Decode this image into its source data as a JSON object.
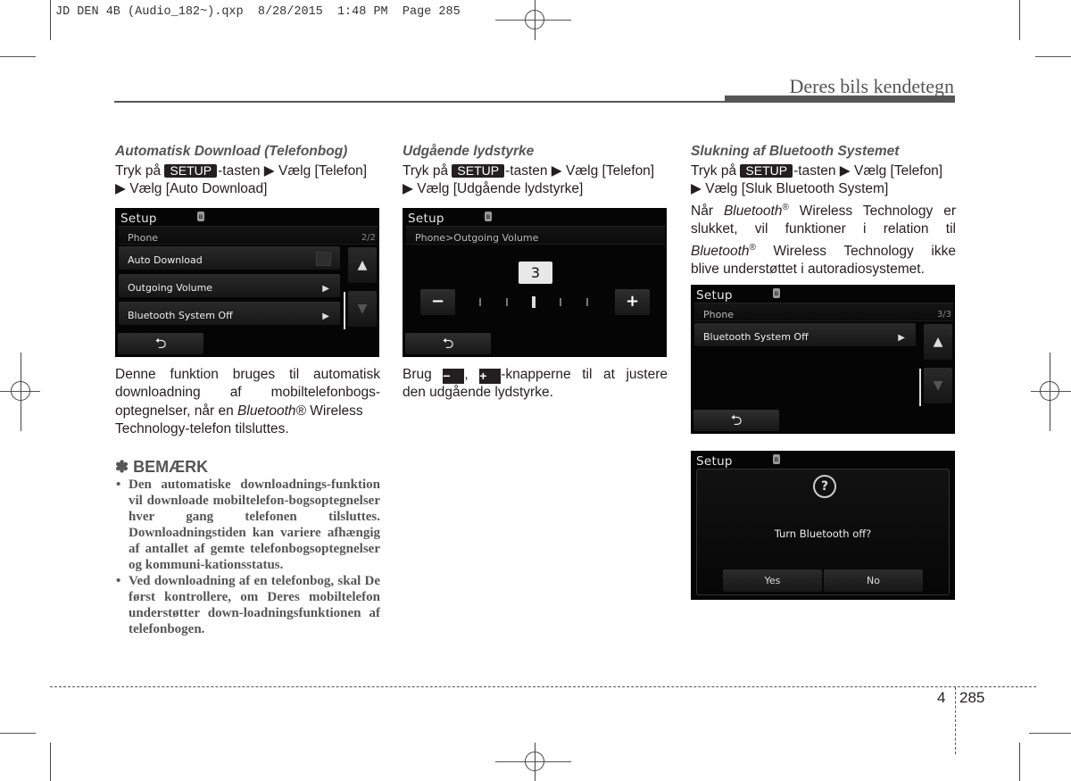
{
  "print_slug": "JD DEN 4B (Audio_182~).qxp  8/28/2015  1:48 PM  Page 285",
  "header": {
    "chapter_title": "Deres bils kendetegn"
  },
  "key_label": "SETUP",
  "col1": {
    "subtitle": "Automatisk Download (Telefonbog)",
    "step_prefix": "Tryk på ",
    "step_mid": "-tasten ▶ Vælg [Telefon]",
    "step_line2": "▶ Vælg [Auto Download]",
    "screen": {
      "title": "Setup",
      "breadcrumb": "Phone",
      "page": "2/2",
      "rows": [
        {
          "label": "Auto Download",
          "control": "checkbox"
        },
        {
          "label": "Outgoing Volume",
          "control": "arrow"
        },
        {
          "label": "Bluetooth System Off",
          "control": "arrow"
        }
      ],
      "up": "▲",
      "down": "▼",
      "back": "⮌"
    },
    "body": [
      "Denne funktion bruges til automatisk",
      "downloadning af mobiltelefonbogs-",
      "optegnelser, når en ",
      "Bluetooth®",
      " Wireless",
      "Technology-telefon tilsluttes."
    ],
    "note": {
      "heading": "✽ BEMÆRK",
      "items": [
        "Den automatiske downloadnings-funktion vil downloade mobiltelefon-bogsoptegnelser hver gang telefonen tilsluttes. Downloadningstiden kan variere afhængig af antallet af gemte telefonbogsoptegnelser og kommuni-kationsstatus.",
        "Ved downloadning af en telefonbog, skal De først kontrollere, om Deres mobiltelefon understøtter down-loadningsfunktionen af telefonbogen."
      ]
    }
  },
  "col2": {
    "subtitle": "Udgående lydstyrke",
    "step_prefix": "Tryk på ",
    "step_mid": "-tasten ▶ Vælg [Telefon]",
    "step_line2": "▶ Vælg [Udgående lydstyrke]",
    "screen": {
      "title": "Setup",
      "breadcrumb": "Phone>Outgoing Volume",
      "volume_value": "3",
      "volume_level": 3,
      "volume_steps": 5,
      "minus": "−",
      "plus": "+",
      "back": "⮌"
    },
    "body_brug": "Brug ",
    "body_comma": ", ",
    "body_rest": "-knapperne til at justere",
    "body_line2": "den udgående lydstyrke.",
    "minus_key": "−",
    "plus_key": "+"
  },
  "col3": {
    "subtitle": "Slukning af Bluetooth Systemet",
    "step_prefix": "Tryk på ",
    "step_mid": "-tasten ▶ Vælg [Telefon]",
    "step_line2": "▶ Vælg [Sluk Bluetooth System]",
    "body": {
      "l1a": "Når ",
      "bt": "Bluetooth",
      "reg": "®",
      "l1b": " Wireless Technology er",
      "l2": "slukket, vil funktioner i relation til",
      "l3b": " Wireless Technology ikke",
      "l4": "blive understøttet i autoradiosystemet."
    },
    "screen1": {
      "title": "Setup",
      "breadcrumb": "Phone",
      "page": "3/3",
      "rows": [
        {
          "label": "Bluetooth System Off",
          "control": "arrow"
        }
      ],
      "up": "▲",
      "down": "▼",
      "back": "⮌"
    },
    "screen2": {
      "title": "Setup",
      "icon": "?",
      "message": "Turn Bluetooth off?",
      "yes": "Yes",
      "no": "No"
    }
  },
  "footer": {
    "chapter_number": "4",
    "page_number": "285"
  }
}
